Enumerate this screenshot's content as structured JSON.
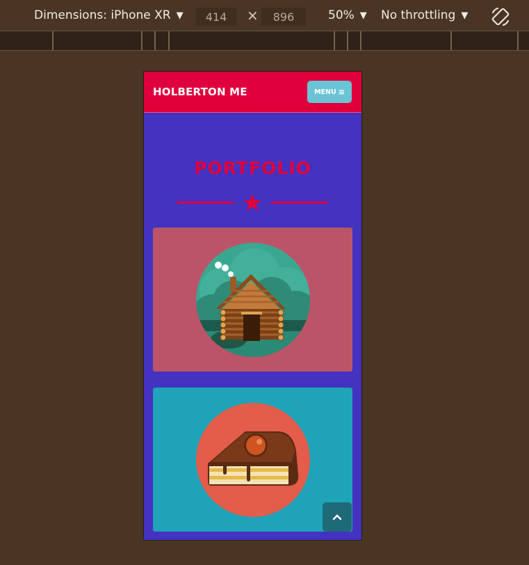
{
  "devtools": {
    "dimensions_label": "Dimensions: iPhone XR",
    "width": "414",
    "times": "×",
    "height": "896",
    "zoom": "50%",
    "throttling": "No throttling",
    "caret": "▼",
    "rotate_icon": "rotate-icon"
  },
  "page": {
    "brand": "HOLBERTON ME",
    "menu_label": "MENU",
    "menu_icon": "≡",
    "section_title": "PORTFOLIO",
    "star_icon": "star-icon",
    "portfolio_items": [
      {
        "icon": "log-cabin-icon",
        "bg": "#bb5468"
      },
      {
        "icon": "cake-slice-icon",
        "bg": "#1fa3b8"
      }
    ],
    "back_to_top_icon": "chevron-up-icon"
  },
  "colors": {
    "nav": "#e0003c",
    "page_bg": "#4432c0",
    "menu_button": "#6ac4d6",
    "accent": "#e0003c"
  }
}
